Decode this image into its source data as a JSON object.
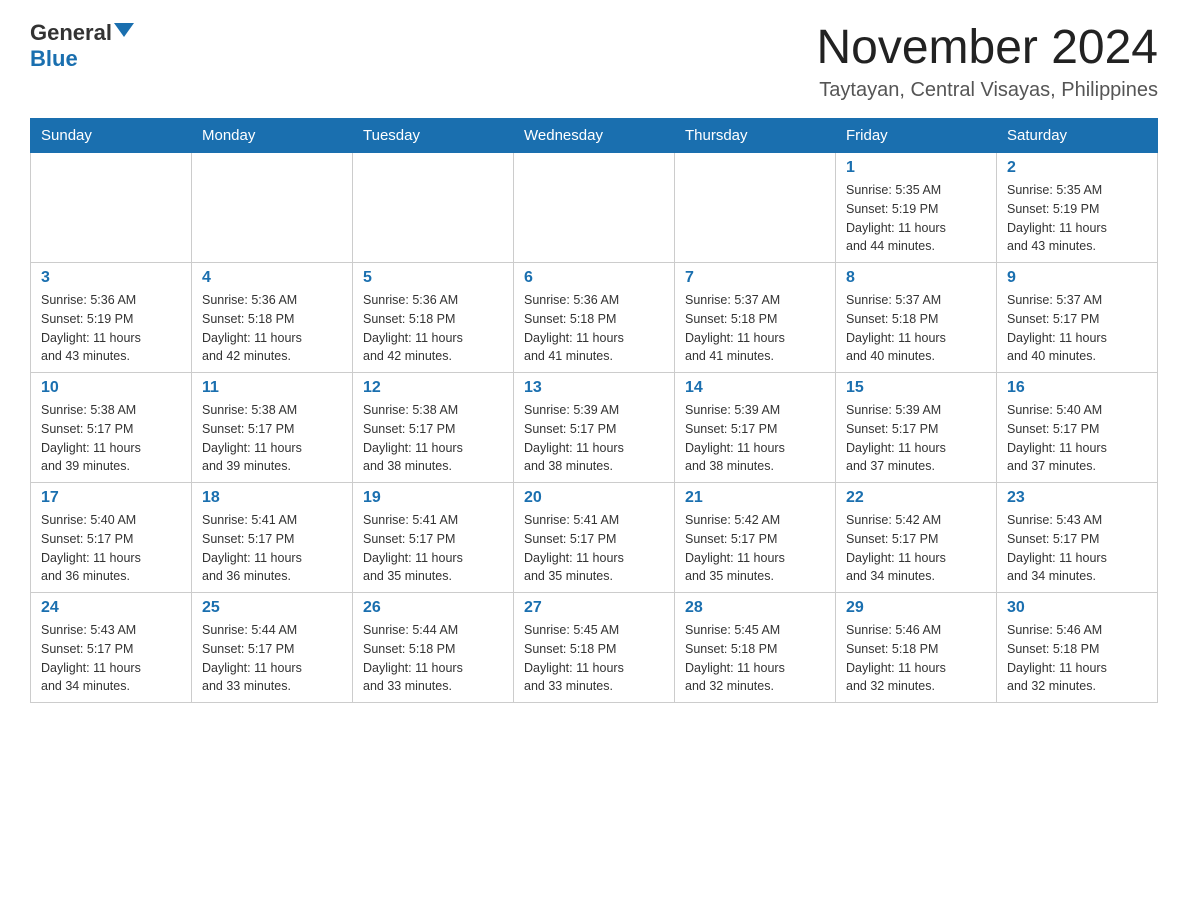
{
  "header": {
    "logo_general": "General",
    "logo_blue": "Blue",
    "month_title": "November 2024",
    "location": "Taytayan, Central Visayas, Philippines"
  },
  "days_of_week": [
    "Sunday",
    "Monday",
    "Tuesday",
    "Wednesday",
    "Thursday",
    "Friday",
    "Saturday"
  ],
  "weeks": [
    [
      {
        "day": "",
        "info": ""
      },
      {
        "day": "",
        "info": ""
      },
      {
        "day": "",
        "info": ""
      },
      {
        "day": "",
        "info": ""
      },
      {
        "day": "",
        "info": ""
      },
      {
        "day": "1",
        "info": "Sunrise: 5:35 AM\nSunset: 5:19 PM\nDaylight: 11 hours\nand 44 minutes."
      },
      {
        "day": "2",
        "info": "Sunrise: 5:35 AM\nSunset: 5:19 PM\nDaylight: 11 hours\nand 43 minutes."
      }
    ],
    [
      {
        "day": "3",
        "info": "Sunrise: 5:36 AM\nSunset: 5:19 PM\nDaylight: 11 hours\nand 43 minutes."
      },
      {
        "day": "4",
        "info": "Sunrise: 5:36 AM\nSunset: 5:18 PM\nDaylight: 11 hours\nand 42 minutes."
      },
      {
        "day": "5",
        "info": "Sunrise: 5:36 AM\nSunset: 5:18 PM\nDaylight: 11 hours\nand 42 minutes."
      },
      {
        "day": "6",
        "info": "Sunrise: 5:36 AM\nSunset: 5:18 PM\nDaylight: 11 hours\nand 41 minutes."
      },
      {
        "day": "7",
        "info": "Sunrise: 5:37 AM\nSunset: 5:18 PM\nDaylight: 11 hours\nand 41 minutes."
      },
      {
        "day": "8",
        "info": "Sunrise: 5:37 AM\nSunset: 5:18 PM\nDaylight: 11 hours\nand 40 minutes."
      },
      {
        "day": "9",
        "info": "Sunrise: 5:37 AM\nSunset: 5:17 PM\nDaylight: 11 hours\nand 40 minutes."
      }
    ],
    [
      {
        "day": "10",
        "info": "Sunrise: 5:38 AM\nSunset: 5:17 PM\nDaylight: 11 hours\nand 39 minutes."
      },
      {
        "day": "11",
        "info": "Sunrise: 5:38 AM\nSunset: 5:17 PM\nDaylight: 11 hours\nand 39 minutes."
      },
      {
        "day": "12",
        "info": "Sunrise: 5:38 AM\nSunset: 5:17 PM\nDaylight: 11 hours\nand 38 minutes."
      },
      {
        "day": "13",
        "info": "Sunrise: 5:39 AM\nSunset: 5:17 PM\nDaylight: 11 hours\nand 38 minutes."
      },
      {
        "day": "14",
        "info": "Sunrise: 5:39 AM\nSunset: 5:17 PM\nDaylight: 11 hours\nand 38 minutes."
      },
      {
        "day": "15",
        "info": "Sunrise: 5:39 AM\nSunset: 5:17 PM\nDaylight: 11 hours\nand 37 minutes."
      },
      {
        "day": "16",
        "info": "Sunrise: 5:40 AM\nSunset: 5:17 PM\nDaylight: 11 hours\nand 37 minutes."
      }
    ],
    [
      {
        "day": "17",
        "info": "Sunrise: 5:40 AM\nSunset: 5:17 PM\nDaylight: 11 hours\nand 36 minutes."
      },
      {
        "day": "18",
        "info": "Sunrise: 5:41 AM\nSunset: 5:17 PM\nDaylight: 11 hours\nand 36 minutes."
      },
      {
        "day": "19",
        "info": "Sunrise: 5:41 AM\nSunset: 5:17 PM\nDaylight: 11 hours\nand 35 minutes."
      },
      {
        "day": "20",
        "info": "Sunrise: 5:41 AM\nSunset: 5:17 PM\nDaylight: 11 hours\nand 35 minutes."
      },
      {
        "day": "21",
        "info": "Sunrise: 5:42 AM\nSunset: 5:17 PM\nDaylight: 11 hours\nand 35 minutes."
      },
      {
        "day": "22",
        "info": "Sunrise: 5:42 AM\nSunset: 5:17 PM\nDaylight: 11 hours\nand 34 minutes."
      },
      {
        "day": "23",
        "info": "Sunrise: 5:43 AM\nSunset: 5:17 PM\nDaylight: 11 hours\nand 34 minutes."
      }
    ],
    [
      {
        "day": "24",
        "info": "Sunrise: 5:43 AM\nSunset: 5:17 PM\nDaylight: 11 hours\nand 34 minutes."
      },
      {
        "day": "25",
        "info": "Sunrise: 5:44 AM\nSunset: 5:17 PM\nDaylight: 11 hours\nand 33 minutes."
      },
      {
        "day": "26",
        "info": "Sunrise: 5:44 AM\nSunset: 5:18 PM\nDaylight: 11 hours\nand 33 minutes."
      },
      {
        "day": "27",
        "info": "Sunrise: 5:45 AM\nSunset: 5:18 PM\nDaylight: 11 hours\nand 33 minutes."
      },
      {
        "day": "28",
        "info": "Sunrise: 5:45 AM\nSunset: 5:18 PM\nDaylight: 11 hours\nand 32 minutes."
      },
      {
        "day": "29",
        "info": "Sunrise: 5:46 AM\nSunset: 5:18 PM\nDaylight: 11 hours\nand 32 minutes."
      },
      {
        "day": "30",
        "info": "Sunrise: 5:46 AM\nSunset: 5:18 PM\nDaylight: 11 hours\nand 32 minutes."
      }
    ]
  ]
}
